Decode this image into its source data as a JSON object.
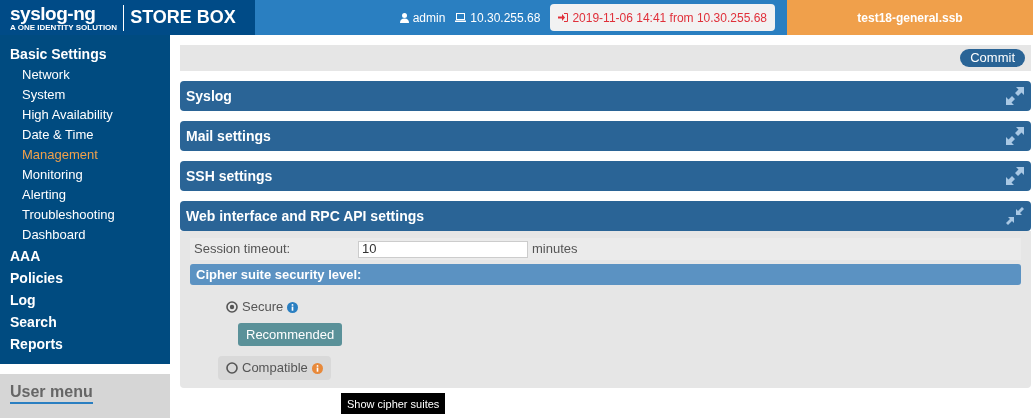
{
  "header": {
    "logo": "syslog-ng",
    "tagline": "A ONE IDENTITY SOLUTION",
    "product": "STORE BOX",
    "user": "admin",
    "host": "10.30.255.68",
    "last_login": "2019-11-06 14:41 from 10.30.255.68",
    "appliance": "test18-general.ssb"
  },
  "sidebar": {
    "items": [
      {
        "label": "Basic Settings",
        "selected": false,
        "children": [
          {
            "label": "Network",
            "selected": false
          },
          {
            "label": "System",
            "selected": false
          },
          {
            "label": "High Availability",
            "selected": false
          },
          {
            "label": "Date & Time",
            "selected": false
          },
          {
            "label": "Management",
            "selected": true
          },
          {
            "label": "Monitoring",
            "selected": false
          },
          {
            "label": "Alerting",
            "selected": false
          },
          {
            "label": "Troubleshooting",
            "selected": false
          },
          {
            "label": "Dashboard",
            "selected": false
          }
        ]
      },
      {
        "label": "AAA",
        "selected": false
      },
      {
        "label": "Policies",
        "selected": false
      },
      {
        "label": "Log",
        "selected": false
      },
      {
        "label": "Search",
        "selected": false
      },
      {
        "label": "Reports",
        "selected": false
      }
    ],
    "user_menu": "User menu"
  },
  "commit_button": "Commit",
  "sections": [
    {
      "title": "Syslog",
      "expanded": false
    },
    {
      "title": "Mail settings",
      "expanded": false
    },
    {
      "title": "SSH settings",
      "expanded": false
    },
    {
      "title": "Web interface and RPC API settings",
      "expanded": true
    }
  ],
  "web_settings": {
    "session_timeout": {
      "label": "Session timeout:",
      "value": "10",
      "unit": "minutes"
    },
    "cipher_heading": "Cipher suite security level:",
    "cipher_options": [
      {
        "label": "Secure",
        "selected": true,
        "color": "#2a7fc1",
        "badge": "Recommended"
      },
      {
        "label": "Compatible",
        "selected": false,
        "color": "#e8893a"
      }
    ]
  },
  "tooltip": "Show cipher suites"
}
